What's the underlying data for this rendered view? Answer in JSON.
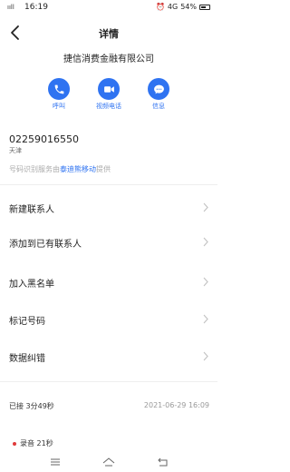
{
  "status_bar": {
    "signal": "ııll",
    "time": "16:19",
    "network": "4G",
    "battery": "54%"
  },
  "header": {
    "title": "详情"
  },
  "contact": {
    "name": "捷信消费金融有限公司",
    "number": "02259016550",
    "location": "天津",
    "provider_prefix": "号码识别服务由",
    "provider_brand": "泰迪熊移动",
    "provider_suffix": "提供"
  },
  "actions": [
    {
      "label": "呼叫",
      "icon": "phone-icon"
    },
    {
      "label": "视频电话",
      "icon": "video-camera-icon"
    },
    {
      "label": "信息",
      "icon": "message-icon"
    }
  ],
  "menu": [
    {
      "label": "新建联系人"
    },
    {
      "label": "添加到已有联系人"
    },
    {
      "label": "加入黑名单"
    },
    {
      "label": "标记号码"
    },
    {
      "label": "数据纠错"
    }
  ],
  "call_log": {
    "status": "已接 3分49秒",
    "datetime": "2021-06-29 16:09",
    "recording": "录音 21秒"
  },
  "colors": {
    "accent": "#2f73f1",
    "recording_dot": "#e03a3a"
  }
}
